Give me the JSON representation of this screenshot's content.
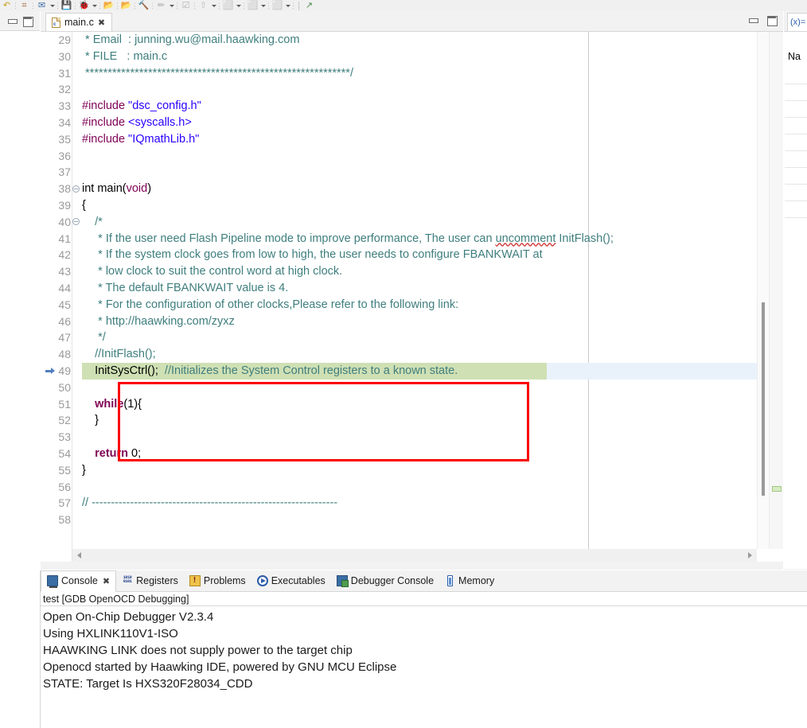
{
  "toolbar": {
    "icons": [
      {
        "name": "undo-icon",
        "glyph": "↶",
        "color": "#c8a020"
      },
      {
        "name": "search-icon",
        "glyph": "⌗",
        "color": "#a06030"
      },
      {
        "name": "mail-icon",
        "glyph": "✉",
        "color": "#3a6ea5"
      },
      {
        "name": "save-icon",
        "glyph": "💾",
        "color": "#5a7fa5"
      },
      {
        "name": "debug-icon",
        "glyph": "🐞",
        "color": "#3a8a6a"
      },
      {
        "name": "open-folder-icon",
        "glyph": "📂",
        "color": "#e0a020"
      },
      {
        "name": "open-folder-2-icon",
        "glyph": "📂",
        "color": "#e0a020"
      },
      {
        "name": "build-icon",
        "glyph": "🔨",
        "color": "#c09030"
      },
      {
        "name": "pencil-icon",
        "glyph": "✏",
        "color": "#b0b0b0"
      },
      {
        "name": "checklist-icon",
        "glyph": "☑",
        "color": "#b0b0b0"
      },
      {
        "name": "export-icon",
        "glyph": "⇧",
        "color": "#c0c0c0"
      },
      {
        "name": "comment-icon",
        "glyph": "⬜",
        "color": "#c0c0c0"
      },
      {
        "name": "comment-2-icon",
        "glyph": "⬜",
        "color": "#c0c0c0"
      },
      {
        "name": "comment-3-icon",
        "glyph": "⬜",
        "color": "#c0c0c0"
      },
      {
        "name": "new-window-icon",
        "glyph": "↗",
        "color": "#4a8a4a"
      }
    ]
  },
  "left_strip": {
    "minimize_label": "Minimize",
    "maximize_label": "Maximize"
  },
  "editor": {
    "tab_label": "main.c",
    "tab_close": "✖",
    "minimize_label": "Minimize",
    "maximize_label": "Maximize",
    "print_margin": true,
    "lines": [
      {
        "no": "29",
        "fold": "",
        "html": "<span class=\"cmt\"> * Email  : junning.wu@mail.haawking.com</span>"
      },
      {
        "no": "30",
        "fold": "",
        "html": "<span class=\"cmt\"> * FILE   : main.c</span>"
      },
      {
        "no": "31",
        "fold": "",
        "html": "<span class=\"cmt\"> ***********************************************************/</span>"
      },
      {
        "no": "32",
        "fold": "",
        "html": ""
      },
      {
        "no": "33",
        "fold": "",
        "html": "<span class=\"ppc\">#include</span> <span class=\"str\">\"dsc_config.h\"</span>"
      },
      {
        "no": "34",
        "fold": "",
        "html": "<span class=\"ppc\">#include</span> <span class=\"str\">&lt;syscalls.h&gt;</span>"
      },
      {
        "no": "35",
        "fold": "",
        "html": "<span class=\"ppc\">#include</span> <span class=\"str\">\"IQmathLib.h\"</span>"
      },
      {
        "no": "36",
        "fold": "",
        "html": ""
      },
      {
        "no": "37",
        "fold": "",
        "html": ""
      },
      {
        "no": "38",
        "fold": "-",
        "html": "int main(<span class=\"kw2\">void</span>)"
      },
      {
        "no": "39",
        "fold": "",
        "html": "{"
      },
      {
        "no": "40",
        "fold": "-",
        "html": "    <span class=\"cmt\">/*</span>"
      },
      {
        "no": "41",
        "fold": "",
        "html": "<span class=\"cmt\">     * If the user need Flash Pipeline mode to improve performance, The user can <span class=\"spell\">uncomment</span> InitFlash();</span>"
      },
      {
        "no": "42",
        "fold": "",
        "html": "<span class=\"cmt\">     * If the system clock goes from low to high, the user needs to configure FBANKWAIT at</span>"
      },
      {
        "no": "43",
        "fold": "",
        "html": "<span class=\"cmt\">     * low clock to suit the control word at high clock.</span>"
      },
      {
        "no": "44",
        "fold": "",
        "html": "<span class=\"cmt\">     * The default FBANKWAIT value is 4.</span>"
      },
      {
        "no": "45",
        "fold": "",
        "html": "<span class=\"cmt\">     * For the configuration of other clocks,Please refer to the following link:</span>"
      },
      {
        "no": "46",
        "fold": "",
        "html": "<span class=\"cmt\">     * http://haawking.com/zyxz</span>"
      },
      {
        "no": "47",
        "fold": "",
        "html": "<span class=\"cmt\">     */</span>"
      },
      {
        "no": "48",
        "fold": "",
        "html": "    <span class=\"cmt\">//InitFlash();</span>"
      },
      {
        "no": "49",
        "fold": "",
        "html": "    InitSysCtrl();  <span class=\"cmt\">//Initializes the System Control registers to a known state.</span>"
      },
      {
        "no": "50",
        "fold": "",
        "html": ""
      },
      {
        "no": "51",
        "fold": "",
        "html": "    <span class=\"kw\">while</span>(1){"
      },
      {
        "no": "52",
        "fold": "",
        "html": "    }"
      },
      {
        "no": "53",
        "fold": "",
        "html": ""
      },
      {
        "no": "54",
        "fold": "",
        "html": "    <span class=\"kw\">return</span> 0;"
      },
      {
        "no": "55",
        "fold": "",
        "html": "}"
      },
      {
        "no": "56",
        "fold": "",
        "html": ""
      },
      {
        "no": "57",
        "fold": "",
        "html": "<span class=\"cmt\">// ----------------------------------------------------------------</span>"
      },
      {
        "no": "58",
        "fold": "",
        "html": ""
      }
    ],
    "current_line": "49",
    "annotation": {
      "type": "red-rectangle",
      "color": "#fb0000",
      "covers_lines": "48-52"
    },
    "highlight_color": "#cfe0b4",
    "selection_color": "#e9f2fb"
  },
  "variables_panel": {
    "tab_label": "(x)= V",
    "column_header": "Na"
  },
  "console": {
    "tabs": [
      {
        "label": "Console",
        "icon": "console-icon",
        "active": true,
        "closable": true
      },
      {
        "label": "Registers",
        "icon": "registers-icon",
        "active": false,
        "closable": false
      },
      {
        "label": "Problems",
        "icon": "problems-icon",
        "active": false,
        "closable": false
      },
      {
        "label": "Executables",
        "icon": "executables-icon",
        "active": false,
        "closable": false
      },
      {
        "label": "Debugger Console",
        "icon": "debugger-console-icon",
        "active": false,
        "closable": false
      },
      {
        "label": "Memory",
        "icon": "memory-icon",
        "active": false,
        "closable": false
      }
    ],
    "close_glyph": "✖",
    "title": "test [GDB OpenOCD Debugging]",
    "output": [
      "Open On-Chip Debugger V2.3.4",
      "Using HXLINK110V1-ISO",
      "HAAWKING LINK does not supply power to the target chip",
      "Openocd started by Haawking IDE, powered by GNU MCU Eclipse",
      "STATE: Target Is HXS320F28034_CDD"
    ]
  }
}
